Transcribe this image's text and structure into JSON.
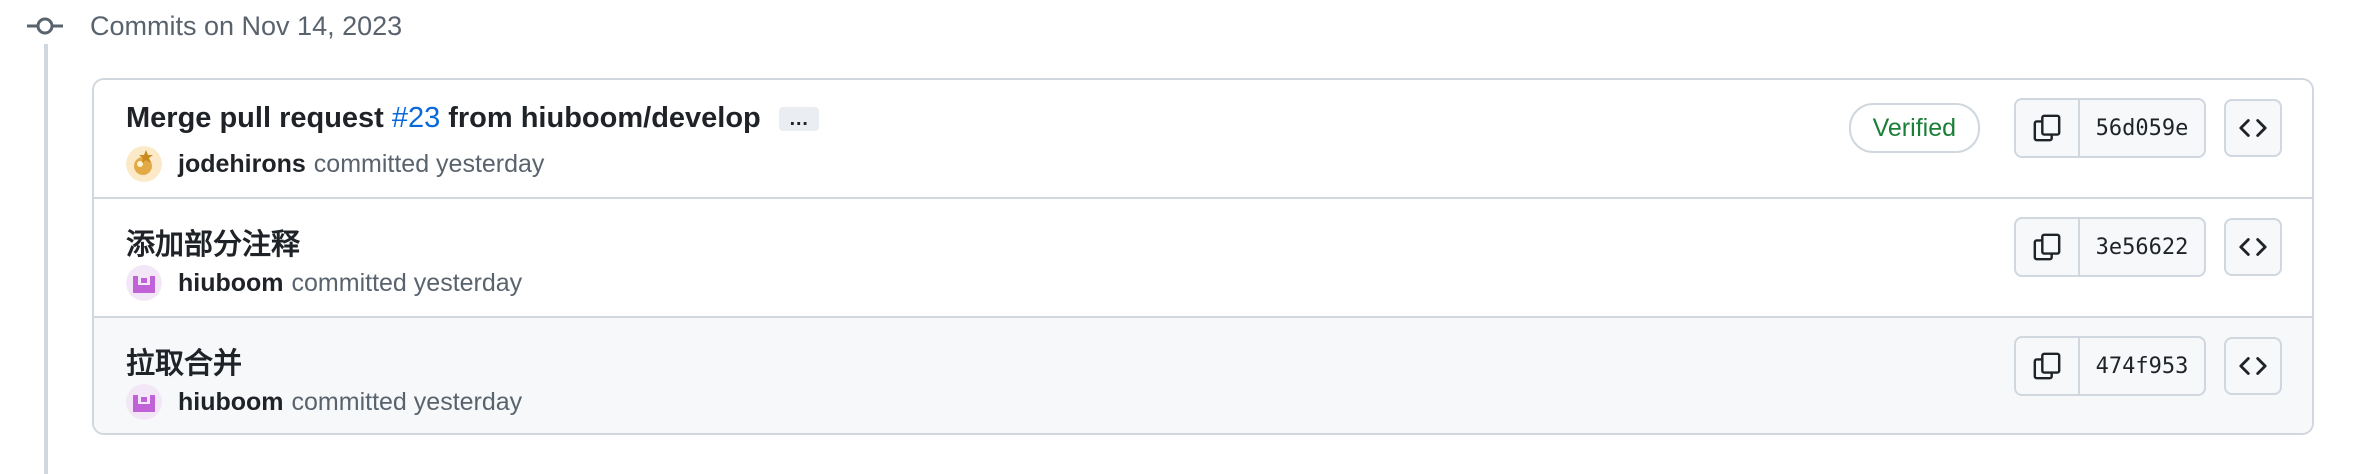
{
  "group": {
    "title": "Commits on Nov 14, 2023"
  },
  "commits": [
    {
      "title_prefix": "Merge pull request",
      "pr_link": "#23",
      "title_suffix": "from hiuboom/develop",
      "ellipsis": "…",
      "author": "jodehirons",
      "committed": "committed yesterday",
      "badge": "Verified",
      "sha": "56d059e"
    },
    {
      "title": "添加部分注释",
      "author": "hiuboom",
      "committed": "committed yesterday",
      "sha": "3e56622"
    },
    {
      "title": "拉取合并",
      "author": "hiuboom",
      "committed": "committed yesterday",
      "sha": "474f953"
    }
  ],
  "colors": {
    "verified": "#1a7f37",
    "link": "#0969da",
    "avatar_hiuboom": "#c061d8"
  },
  "icons": {
    "commit": "git-commit-icon",
    "copy": "copy-icon",
    "browse": "code-icon",
    "avatar_jodehirons": "avatar-icon",
    "avatar_hiuboom": "avatar-icon"
  }
}
